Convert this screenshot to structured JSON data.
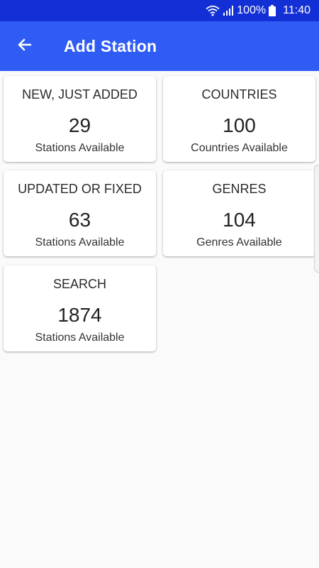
{
  "status_bar": {
    "battery_percent": "100%",
    "time": "11:40",
    "icons": [
      "wifi-icon",
      "signal-icon",
      "battery-icon"
    ]
  },
  "app_bar": {
    "title": "Add Station",
    "back_icon": "arrow-left-icon",
    "color": "#2f5cf5",
    "status_color": "#1330d6"
  },
  "cards": [
    {
      "title": "NEW, JUST ADDED",
      "count": "29",
      "subtitle": "Stations Available"
    },
    {
      "title": "COUNTRIES",
      "count": "100",
      "subtitle": "Countries Available"
    },
    {
      "title": "UPDATED OR FIXED",
      "count": "63",
      "subtitle": "Stations Available"
    },
    {
      "title": "GENRES",
      "count": "104",
      "subtitle": "Genres Available"
    },
    {
      "title": "SEARCH",
      "count": "1874",
      "subtitle": "Stations Available"
    }
  ]
}
